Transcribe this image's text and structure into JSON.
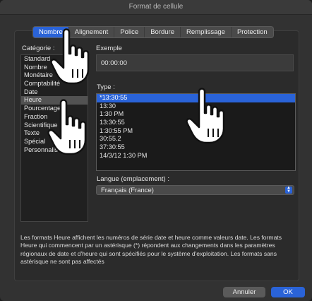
{
  "window": {
    "title": "Format de cellule"
  },
  "tabs": [
    {
      "label": "Nombre",
      "active": true
    },
    {
      "label": "Alignement",
      "active": false
    },
    {
      "label": "Police",
      "active": false
    },
    {
      "label": "Bordure",
      "active": false
    },
    {
      "label": "Remplissage",
      "active": false
    },
    {
      "label": "Protection",
      "active": false
    }
  ],
  "category": {
    "label": "Catégorie :",
    "items": [
      "Standard",
      "Nombre",
      "Monétaire",
      "Comptabilité",
      "Date",
      "Heure",
      "Pourcentage",
      "Fraction",
      "Scientifique",
      "Texte",
      "Spécial",
      "Personnalisée"
    ],
    "selected": "Heure"
  },
  "example": {
    "label": "Exemple",
    "value": "00:00:00"
  },
  "type": {
    "label": "Type :",
    "items": [
      "*13:30:55",
      "13:30",
      "1:30 PM",
      "13:30:55",
      "1:30:55 PM",
      "30:55.2",
      "37:30:55",
      "14/3/12 1:30 PM"
    ],
    "selected": "*13:30:55"
  },
  "locale": {
    "label": "Langue (emplacement) :",
    "value": "Français (France)"
  },
  "description": "Les formats Heure affichent les numéros de série date et heure comme valeurs date. Les formats Heure qui commencent par un astérisque (*) répondent aux changements dans les paramètres régionaux de date et d'heure qui sont spécifiés pour le système d'exploitation. Les formats sans astérisque ne sont pas affectés",
  "buttons": {
    "cancel": "Annuler",
    "ok": "OK"
  },
  "icons": [
    "hand-pointer-icon"
  ]
}
